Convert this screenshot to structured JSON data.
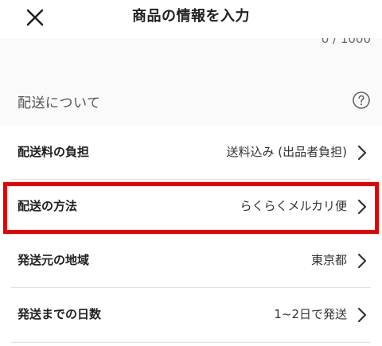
{
  "header": {
    "title": "商品の情報を入力",
    "close_icon": "close-icon"
  },
  "description": {
    "char_count": "0 / 1000"
  },
  "shipping": {
    "section_title": "配送について",
    "help_icon": "help-circle-icon",
    "rows": [
      {
        "label": "配送料の負担",
        "value": "送料込み (出品者負担)",
        "icon": "chevron-right-icon"
      },
      {
        "label": "配送の方法",
        "value": "らくらくメルカリ便",
        "icon": "chevron-right-icon",
        "highlighted": true
      },
      {
        "label": "発送元の地域",
        "value": "東京都",
        "icon": "chevron-right-icon"
      },
      {
        "label": "発送までの日数",
        "value": "1~2日で発送",
        "icon": "chevron-right-icon"
      }
    ]
  },
  "colors": {
    "highlight": "#e60000",
    "divider": "#e2e2e2",
    "section_bg": "#fafafa",
    "text": "#222222"
  }
}
